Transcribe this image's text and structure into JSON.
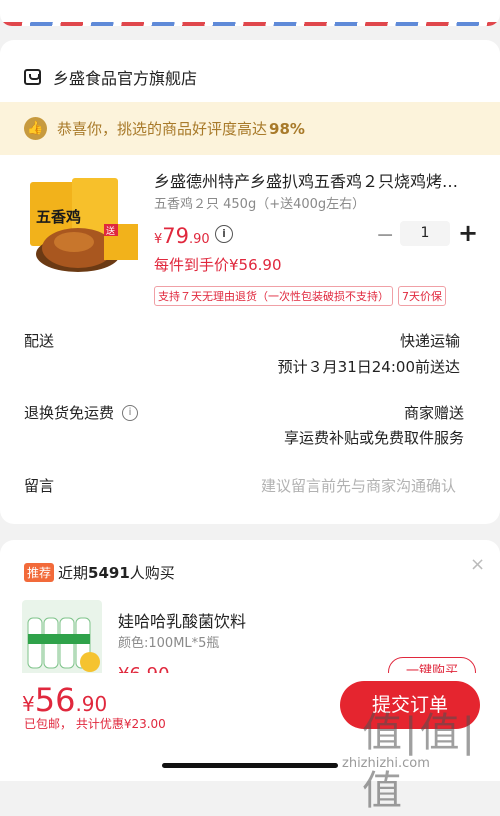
{
  "shop": {
    "name": "乡盛食品官方旗舰店",
    "icon": "shop-icon"
  },
  "praise": {
    "text": "恭喜你，挑选的商品好评度高达",
    "percent": "98%",
    "icon": "thumbs-up-icon"
  },
  "product": {
    "title": "乡盛德州特产乡盛扒鸡五香鸡２只烧鸡烤…",
    "spec": "五香鸡２只 450g（+送400g左右）",
    "price_symbol": "¥",
    "price_int": "79",
    "price_dec": ".90",
    "per_price": "每件到手价¥56.90",
    "quantity": "1",
    "minus_label": "−",
    "plus_label": "+",
    "tags": [
      "支持７天无理由退货（一次性包装破损不支持）",
      "7天价保"
    ],
    "image_text": "五香鸡",
    "gift_label": "送"
  },
  "form": {
    "delivery_label": "配送",
    "delivery_method": "快递运输",
    "delivery_eta": "预计３月31日24:00前送达",
    "return_label": "退换货免运费",
    "return_value1": "商家赠送",
    "return_value2": "享运费补贴或免费取件服务",
    "remark_label": "留言",
    "remark_placeholder": "建议留言前先与商家沟通确认"
  },
  "recommend": {
    "badge": "推荐",
    "text_prefix": "近期",
    "count": "5491",
    "text_suffix": "人购买",
    "title": "娃哈哈乳酸菌饮料",
    "spec": "颜色:100ML*5瓶",
    "price": "¥6.90",
    "buy_label": "一键购买",
    "close_label": "×"
  },
  "bottom": {
    "total_symbol": "¥",
    "total_int": "56",
    "total_dec": ".90",
    "note": "已包邮， 共计优惠¥23.00",
    "submit_label": "提交订单"
  },
  "watermark": {
    "main": "值|值|值",
    "sub": "zhizhizhi.com"
  },
  "colors": {
    "accent_red": "#e0283d",
    "praise_bg": "#fcf3db",
    "praise_text": "#a87a2a"
  }
}
